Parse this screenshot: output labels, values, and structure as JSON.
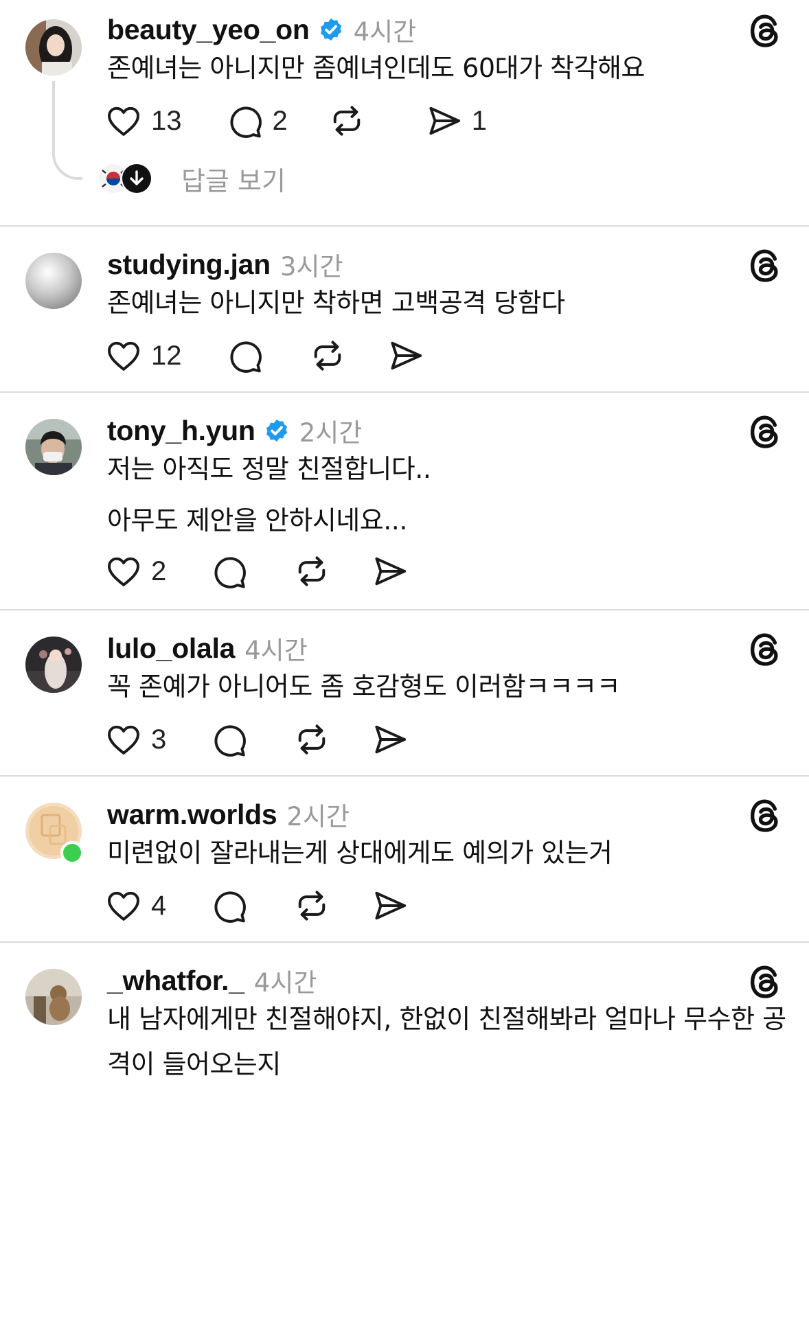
{
  "posts": [
    {
      "username": "beauty_yeo_on",
      "verified": true,
      "time": "4시간",
      "lines": [
        "존예녀는 아니지만 좀예녀인데도 60대가 착각해요"
      ],
      "likes": "13",
      "replies": "2",
      "reposts": "",
      "shares": "1",
      "view_replies_label": "답글 보기"
    },
    {
      "username": "studying.jan",
      "verified": false,
      "time": "3시간",
      "lines": [
        "존예녀는 아니지만 착하면 고백공격 당함다"
      ],
      "likes": "12",
      "replies": "",
      "reposts": "",
      "shares": ""
    },
    {
      "username": "tony_h.yun",
      "verified": true,
      "time": "2시간",
      "lines": [
        "저는 아직도 정말 친절합니다..",
        "아무도 제안을 안하시네요..."
      ],
      "likes": "2",
      "replies": "",
      "reposts": "",
      "shares": ""
    },
    {
      "username": "lulo_olala",
      "verified": false,
      "time": "4시간",
      "lines": [
        "꼭 존예가 아니어도 좀 호감형도 이러함ㅋㅋㅋㅋ"
      ],
      "likes": "3",
      "replies": "",
      "reposts": "",
      "shares": ""
    },
    {
      "username": "warm.worlds",
      "verified": false,
      "online": true,
      "time": "2시간",
      "lines": [
        "미련없이 잘라내는게 상대에게도 예의가 있는거"
      ],
      "likes": "4",
      "replies": "",
      "reposts": "",
      "shares": ""
    },
    {
      "username": "_whatfor._",
      "verified": false,
      "time": "4시간",
      "lines": [
        "내 남자에게만 친절해야지, 한없이 친절해봐라 얼마나 무수한 공격이 들어오는지"
      ],
      "likes": "",
      "replies": "",
      "reposts": "",
      "shares": ""
    }
  ],
  "icons": {
    "like": "heart-icon",
    "reply": "speech-bubble-icon",
    "repost": "repost-arrows-icon",
    "share": "paper-plane-icon",
    "brand": "threads-logo-icon",
    "verified": "verified-badge-icon"
  },
  "colors": {
    "verified_blue": "#1d9bf0",
    "muted_text": "#999999",
    "online_green": "#3ccf4e",
    "divider": "#dcdcdc"
  }
}
